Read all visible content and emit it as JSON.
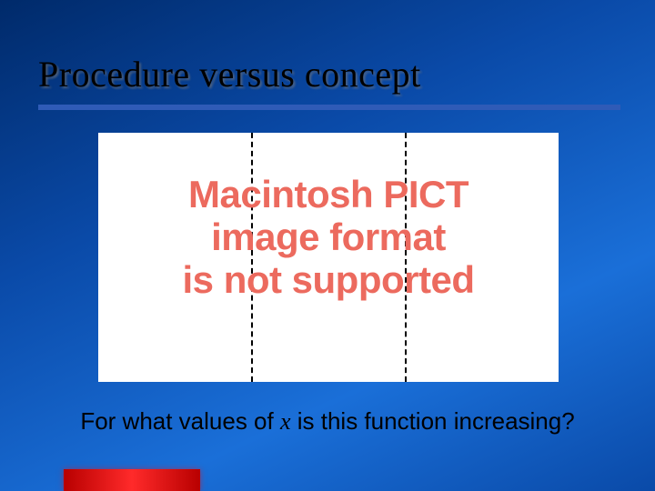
{
  "slide": {
    "title": "Procedure versus concept",
    "placeholder": {
      "line1": "Macintosh PICT",
      "line2": "image format",
      "line3": "is not supported"
    },
    "question": {
      "prefix": "For what values of ",
      "var": "x",
      "suffix": " is this function increasing?"
    }
  }
}
